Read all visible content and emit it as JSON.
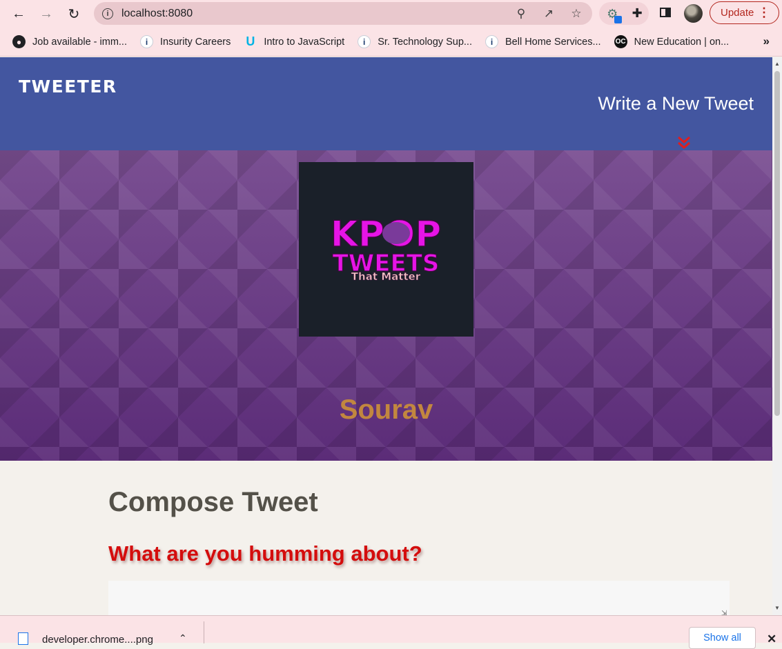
{
  "browser": {
    "url": "localhost:8080",
    "update_label": "Update",
    "bookmarks": [
      {
        "label": "Job available - imm...",
        "icon": "globe-icon"
      },
      {
        "label": "Insurity Careers",
        "icon": "info-icon"
      },
      {
        "label": "Intro to JavaScript",
        "icon": "udacity-icon"
      },
      {
        "label": "Sr. Technology Sup...",
        "icon": "info-icon"
      },
      {
        "label": "Bell Home Services...",
        "icon": "info-icon"
      },
      {
        "label": "New Education | on...",
        "icon": "oc-icon"
      }
    ]
  },
  "app": {
    "brand": "TWEETER",
    "compose_link": "Write a New Tweet",
    "user": {
      "name": "Sourav",
      "avatar_text": {
        "line1": "KPOP",
        "line2": "TWEETS",
        "line3": "That Matter"
      }
    },
    "compose": {
      "title": "Compose Tweet",
      "prompt": "What are you humming about?",
      "textarea_value": ""
    }
  },
  "download_shelf": {
    "file_name": "developer.chrome....png",
    "show_all_label": "Show all"
  },
  "colors": {
    "nav_bg": "#4356a0",
    "hero_bg": "#6b3d85",
    "username": "#c2873f",
    "prompt": "#d40d0d",
    "chevron": "#e31c1c"
  }
}
